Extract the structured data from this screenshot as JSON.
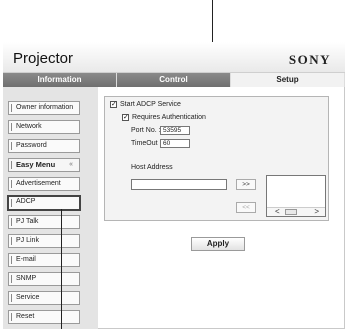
{
  "header": {
    "title": "Projector",
    "brand": "SONY"
  },
  "tabs": [
    {
      "label": "Information"
    },
    {
      "label": "Control"
    },
    {
      "label": "Setup"
    }
  ],
  "sidebar": {
    "items": [
      {
        "label": "Owner information"
      },
      {
        "label": "Network"
      },
      {
        "label": "Password"
      },
      {
        "label": "Easy Menu",
        "chevron": "«"
      },
      {
        "label": "Advertisement"
      },
      {
        "label": "ADCP"
      },
      {
        "label": "PJ Talk"
      },
      {
        "label": "PJ Link"
      },
      {
        "label": "E-mail"
      },
      {
        "label": "SNMP"
      },
      {
        "label": "Service"
      },
      {
        "label": "Reset"
      }
    ]
  },
  "adcp": {
    "start_service": {
      "label": "Start ADCP Service",
      "checked": true,
      "mark": "✓"
    },
    "requires_auth": {
      "label": "Requires Authentication",
      "checked": true,
      "mark": "✓"
    },
    "port": {
      "label": "Port No. :",
      "value": "53595"
    },
    "timeout": {
      "label": "TimeOut :",
      "value": "60"
    },
    "host": {
      "label": "Host Address",
      "value": ""
    },
    "add_label": ">>",
    "remove_label": "<<",
    "scroll_left": "<",
    "scroll_right": ">"
  },
  "apply_label": "Apply"
}
